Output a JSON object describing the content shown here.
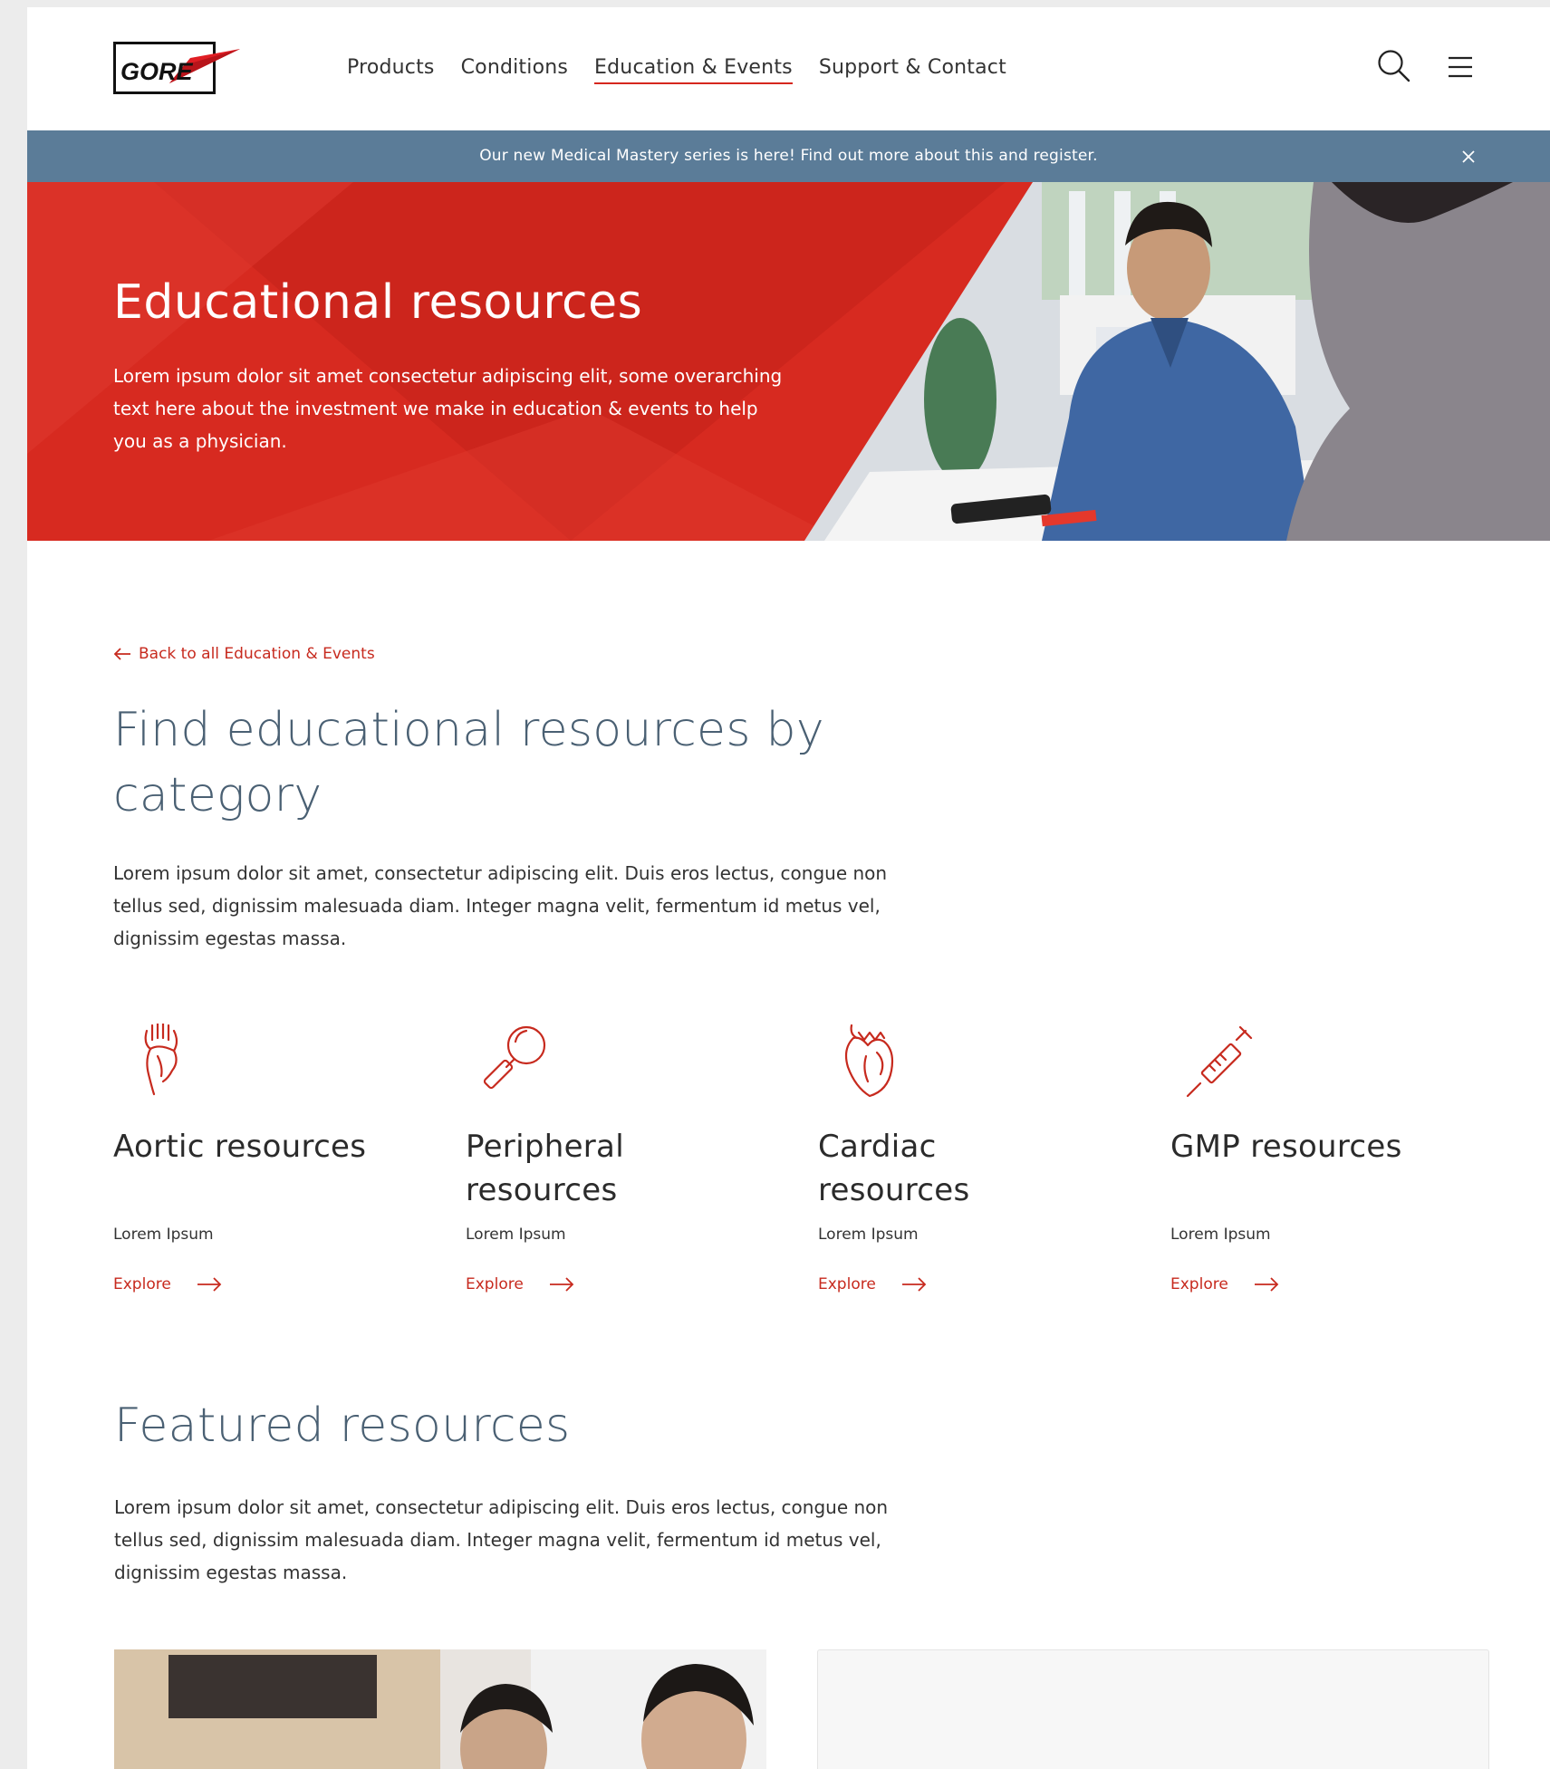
{
  "header": {
    "logo_text": "GORE",
    "nav": [
      {
        "label": "Products",
        "active": false
      },
      {
        "label": "Conditions",
        "active": false
      },
      {
        "label": "Education & Events",
        "active": true
      },
      {
        "label": "Support & Contact",
        "active": false
      }
    ],
    "icons": {
      "search": "search-icon",
      "menu": "hamburger-menu-icon"
    }
  },
  "announcement": {
    "text": "Our new Medical Mastery series is here! Find out more about this and register.",
    "close_icon": "close-icon"
  },
  "hero": {
    "title": "Educational resources",
    "description": "Lorem ipsum dolor sit amet consectetur adipiscing elit, some overarching text here about the investment we make in education & events to help you as a physician."
  },
  "main": {
    "back_link": "Back to all Education & Events",
    "section_title": "Find educational resources by category",
    "section_desc": "Lorem ipsum dolor sit amet, consectetur adipiscing elit. Duis eros lectus, congue non tellus sed, dignissim malesuada diam. Integer magna velit, fermentum id metus vel, dignissim egestas massa.",
    "categories": [
      {
        "title": "Aortic resources",
        "subtitle": "Lorem Ipsum",
        "link": "Explore",
        "icon": "aorta-icon"
      },
      {
        "title": "Peripheral resources",
        "subtitle": "Lorem Ipsum",
        "link": "Explore",
        "icon": "magnifier-icon"
      },
      {
        "title": "Cardiac resources",
        "subtitle": "Lorem Ipsum",
        "link": "Explore",
        "icon": "heart-icon"
      },
      {
        "title": "GMP resources",
        "subtitle": "Lorem Ipsum",
        "link": "Explore",
        "icon": "syringe-icon"
      }
    ]
  },
  "featured": {
    "title": "Featured resources",
    "description": "Lorem ipsum dolor sit amet, consectetur adipiscing elit. Duis eros lectus, congue non tellus sed, dignissim malesuada diam. Integer magna velit, fermentum id metus vel, dignissim egestas massa."
  },
  "colors": {
    "brand_red": "#d72a20",
    "link_red": "#c72a1e",
    "announce_bg": "#5b7c98",
    "heading_slate": "#4a6073"
  }
}
